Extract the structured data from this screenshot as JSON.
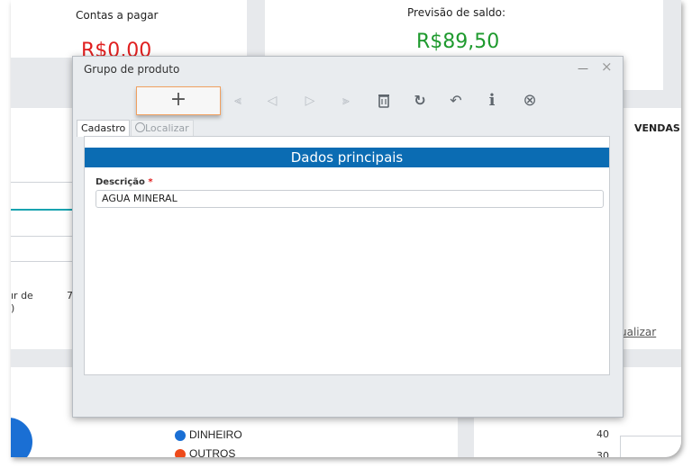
{
  "background": {
    "contas_pagar": {
      "label": "Contas a pagar",
      "value": "R$0,00"
    },
    "previsao": {
      "label": "Previsão de saldo:",
      "value": "R$89,50"
    },
    "vendas_label": "VENDAS",
    "left_text_1": "ır de",
    "left_text_2": ")",
    "left_text_num": "7",
    "atualizar_link": "ualizar",
    "legend": [
      {
        "label": "DINHEIRO",
        "color": "#1a6fd4"
      },
      {
        "label": "OUTROS",
        "color": "#ee4a1a"
      }
    ],
    "axis_ticks": [
      "40",
      "30"
    ],
    "colors": {
      "red": "#e02020",
      "green": "#1e9a2e",
      "teal": "#19a3b0"
    }
  },
  "dialog": {
    "title": "Grupo de produto",
    "window_buttons": {
      "minimize": "—",
      "close": "×"
    },
    "toolbar": {
      "add_label": "+",
      "first_icon": "⫷",
      "prev_icon": "◁",
      "next_icon": "▷",
      "last_icon": "⫸",
      "delete_icon": "🗑",
      "refresh_icon": "↻",
      "undo_icon": "↶",
      "info_icon": "i",
      "cancel_icon": "⊗"
    },
    "tabs": [
      {
        "label": "Cadastro"
      },
      {
        "label": "Localizar"
      }
    ],
    "section_title": "Dados principais",
    "fields": {
      "descricao": {
        "label": "Descrição",
        "required_mark": "*",
        "value": "AGUA MINERAL"
      }
    }
  }
}
